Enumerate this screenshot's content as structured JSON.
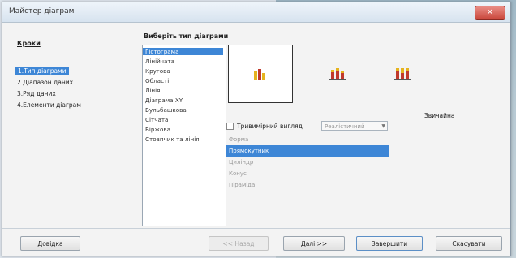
{
  "window": {
    "title": "Майстер діаграм",
    "close_symbol": "✕"
  },
  "steps": {
    "title": "Кроки",
    "items": [
      {
        "label": "1.Тип діаграми",
        "active": true
      },
      {
        "label": "2.Діапазон даних",
        "active": false
      },
      {
        "label": "3.Ряд даних",
        "active": false
      },
      {
        "label": "4.Елементи діаграм",
        "active": false
      }
    ]
  },
  "chart_types": {
    "title": "Виберіть тип діаграми",
    "items": [
      "Гістограма",
      "Лінійчата",
      "Кругова",
      "Області",
      "Лінія",
      "Діаграма XY",
      "Бульбашкова",
      "Сітчата",
      "Біржова",
      "Стовпчик та лінія"
    ],
    "selected_index": 0
  },
  "subtypes": {
    "label": "Звичайна",
    "icons": [
      "bar-chart-normal-icon",
      "bar-chart-stacked-icon",
      "bar-chart-percent-icon"
    ]
  },
  "options": {
    "three_d_label": "Тривимірний вигляд",
    "three_d_select": "Реалістичний",
    "shape_items": [
      "Форма",
      "Прямокутник",
      "Циліндр",
      "Конус",
      "Піраміда"
    ],
    "shape_selected_index": 1
  },
  "buttons": {
    "help": "Довідка",
    "back": "<< Назад",
    "next": "Далі >>",
    "finish": "Завершити",
    "cancel": "Скасувати"
  },
  "colors": {
    "accent": "#3d86d6",
    "bar_red": "#c0392b",
    "bar_yellow": "#e5b31e"
  }
}
